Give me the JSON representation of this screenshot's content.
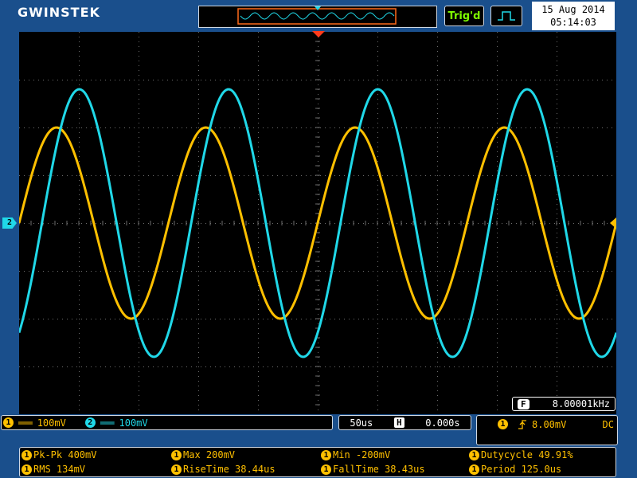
{
  "header": {
    "brand": "GWINSTEK",
    "trigger_status": "Trig'd",
    "trigger_icon": "rising-edge-pulse-icon",
    "date": "15 Aug 2014",
    "time": "05:14:03"
  },
  "channels": [
    {
      "id": "1",
      "coupling_icon": "dc-coupling-icon",
      "scale": "100mV",
      "color": "#ffc000"
    },
    {
      "id": "2",
      "coupling_icon": "dc-coupling-icon",
      "scale": "100mV",
      "color": "#20d8e8"
    }
  ],
  "timebase": {
    "scale": "50us",
    "mode_badge": "H",
    "position": "0.000s"
  },
  "trigger": {
    "source": "1",
    "slope_icon": "rising-slope-icon",
    "level": "8.00mV",
    "coupling": "DC"
  },
  "frequency": {
    "badge": "F",
    "value": "8.00001kHz"
  },
  "measurements": [
    {
      "source": "1",
      "text": "Pk-Pk 400mV"
    },
    {
      "source": "1",
      "text": "Max 200mV"
    },
    {
      "source": "1",
      "text": "Min -200mV"
    },
    {
      "source": "1",
      "text": "Dutycycle 49.91%"
    },
    {
      "source": "1",
      "text": "RMS 134mV"
    },
    {
      "source": "1",
      "text": "RiseTime 38.44us"
    },
    {
      "source": "1",
      "text": "FallTime 38.43us"
    },
    {
      "source": "1",
      "text": "Period 125.0us"
    }
  ],
  "chart_data": {
    "type": "line",
    "x_unit": "us",
    "xlim": [
      -250,
      250
    ],
    "ylim": [
      -400,
      400
    ],
    "y_unit": "mV",
    "grid": true,
    "series": [
      {
        "name": "1",
        "color": "#ffc000",
        "frequency_khz": 8.0,
        "amplitude_mv": 200,
        "phase_deg": 0
      },
      {
        "name": "2",
        "color": "#20d8e8",
        "frequency_khz": 8.0,
        "amplitude_mv": 280,
        "phase_deg": -55
      }
    ]
  }
}
